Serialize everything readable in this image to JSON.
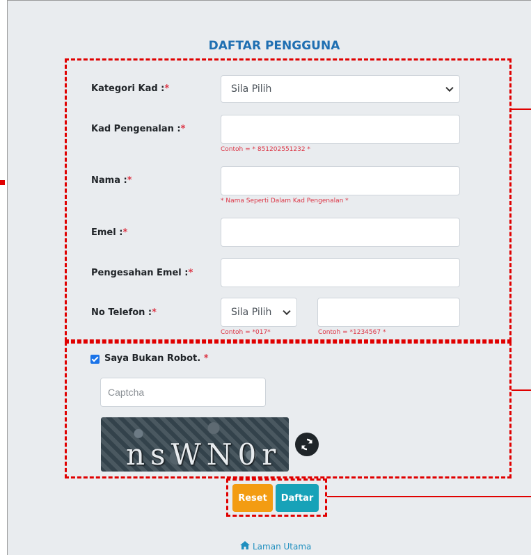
{
  "form": {
    "title": "DAFTAR PENGGUNA",
    "kategori_label": "Kategori Kad :",
    "kategori_value": "Sila Pilih",
    "kp_label": "Kad Pengenalan :",
    "kp_hint": "Contoh = * 851202551232 *",
    "nama_label": "Nama :",
    "nama_hint": "* Nama Seperti Dalam Kad Pengenalan *",
    "emel_label": "Emel :",
    "pengesahan_label": "Pengesahan Emel :",
    "telefon_label": "No Telefon :",
    "telefon_prefix_value": "Sila Pilih",
    "telefon_prefix_hint": "Contoh = *017*",
    "telefon_number_hint": "Contoh = *1234567 *",
    "required_mark": "*"
  },
  "captcha": {
    "robot_label": "Saya Bukan Robot.",
    "robot_checked": true,
    "input_placeholder": "Captcha",
    "code": "nsWN0r"
  },
  "buttons": {
    "reset": "Reset",
    "daftar": "Daftar"
  },
  "footer": {
    "home_link": "Laman Utama"
  },
  "colors": {
    "annotation": "#e00000",
    "title": "#1f6fb2",
    "reset": "#f39c12",
    "daftar": "#17a2b8"
  },
  "icons": [
    "chevron-down-icon",
    "refresh-icon",
    "home-icon",
    "checkbox-checked-icon"
  ]
}
